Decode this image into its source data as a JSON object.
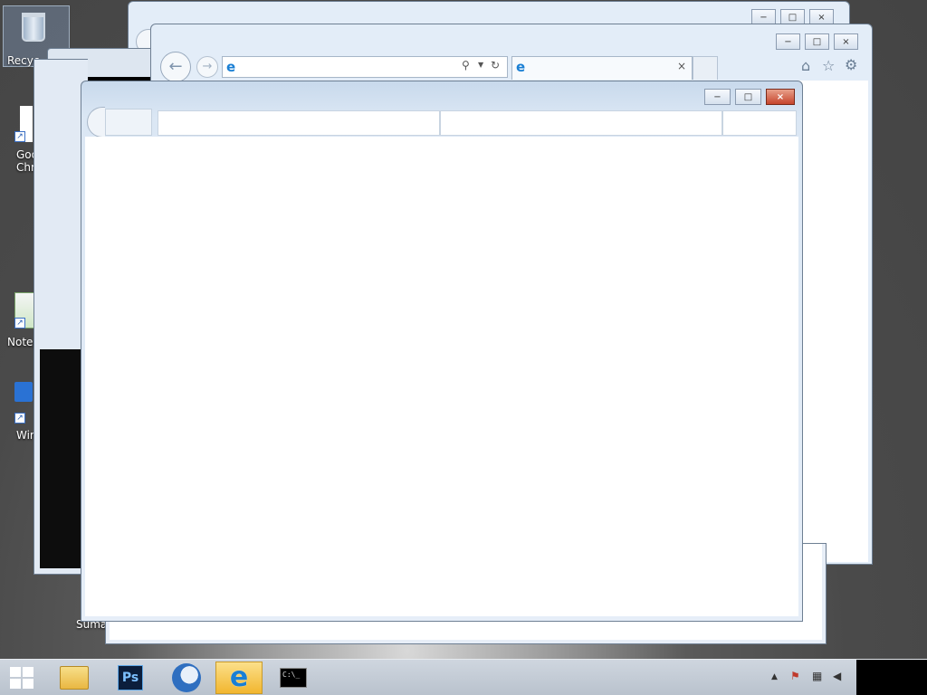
{
  "desktop": {
    "icons": [
      {
        "label": "Recyc",
        "icon": "recycle-bin-icon"
      },
      {
        "label": "Goo",
        "icon": "google-chrome-icon"
      },
      {
        "label": "Chr",
        "icon": "google-chrome-icon"
      },
      {
        "label": "Notep",
        "icon": "notepad-icon"
      },
      {
        "label": "Wir",
        "icon": "shortcut-icon"
      },
      {
        "label": "Suma",
        "icon": "sumatra-pdf-icon"
      }
    ]
  },
  "windows": {
    "cmd": {
      "title": "",
      "icon": "cmd-icon"
    },
    "ie_back1": {
      "title": "",
      "icon": "ie-icon"
    },
    "ie_back2": {
      "address": "",
      "tab_title": "",
      "tab_close": "×",
      "icon": "ie-icon"
    },
    "front": {
      "title": ""
    }
  },
  "caption": {
    "minimize": "−",
    "maximize": "□",
    "close": "×"
  },
  "taskbar": {
    "start_icon": "windows-start-icon",
    "apps": [
      {
        "name": "file-explorer",
        "icon": "folder-icon"
      },
      {
        "name": "photoshop",
        "icon": "photoshop-icon",
        "text": "Ps"
      },
      {
        "name": "thunderbird",
        "icon": "thunderbird-icon"
      },
      {
        "name": "internet-explorer",
        "icon": "ie-icon",
        "active": true
      },
      {
        "name": "command-prompt",
        "icon": "cmd-icon",
        "text": "C:\\_"
      }
    ],
    "tray": {
      "chevron": "▲",
      "icons": [
        "action-center-icon",
        "network-icon",
        "volume-muted-icon"
      ]
    }
  },
  "colors": {
    "accent": "#f2b62f",
    "close_red": "#c6452d",
    "frame": "#dbe7f4"
  }
}
